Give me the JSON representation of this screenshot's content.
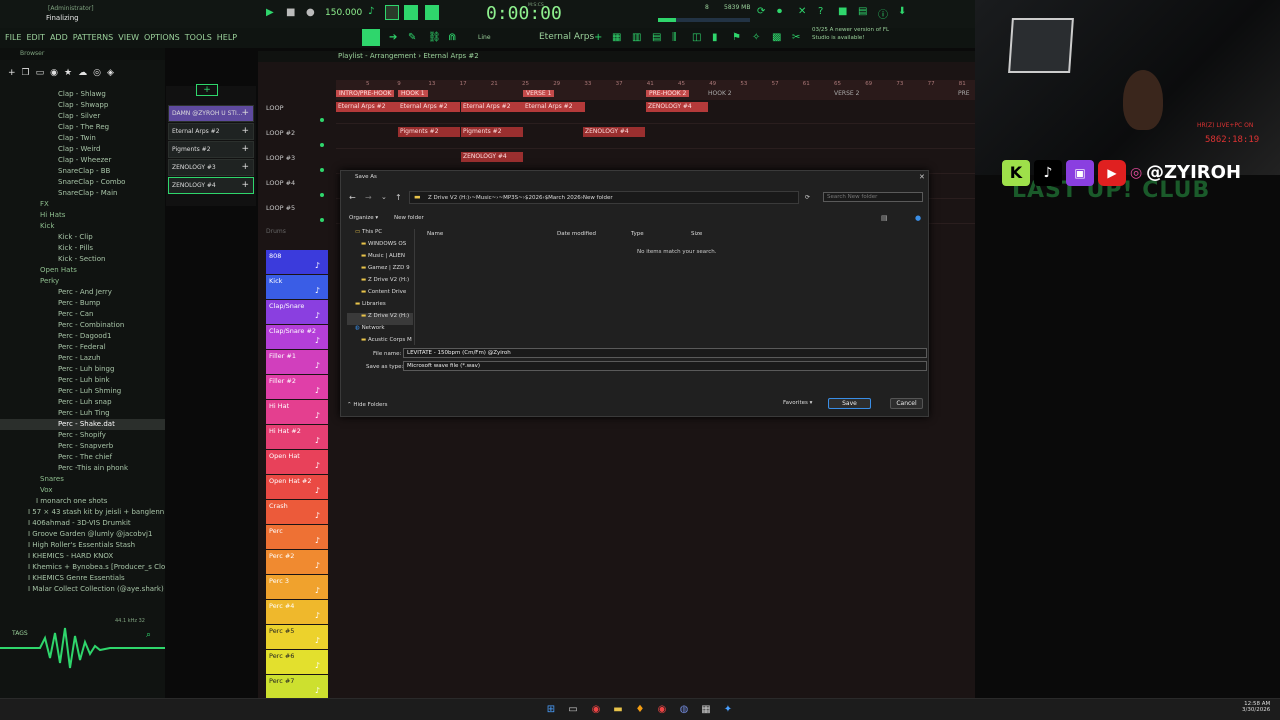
{
  "topbar": {
    "user": "[Administrator]",
    "status": "Finalizing",
    "tempo": "150.000",
    "time": "0:00:00",
    "time_sub": "M:S:CS",
    "cpu": "8",
    "memory": "5839 MB",
    "pattern_name": "Eternal Arps",
    "snap": "Line",
    "hint_time": "03/25",
    "hint_text": "A newer version of FL Studio is available!",
    "counter": "0"
  },
  "menu": [
    "FILE",
    "EDIT",
    "ADD",
    "PATTERNS",
    "VIEW",
    "OPTIONS",
    "TOOLS",
    "HELP"
  ],
  "browser": {
    "title": "Browser",
    "items": [
      "Clap - Shlawg",
      "Clap - Shwapp",
      "Clap - Silver",
      "Clap - The Reg",
      "Clap - Twin",
      "Clap - Weird",
      "Clap - Wheezer",
      "SnareClap - BB",
      "SnareClap - Combo",
      "SnareClap - Main",
      "FX",
      "Hi Hats",
      "Kick",
      "Kick - Clip",
      "Kick - Pills",
      "Kick - Section",
      "Open Hats",
      "Perky",
      "Perc - And Jerry",
      "Perc - Bump",
      "Perc - Can",
      "Perc - Combination",
      "Perc - Dagood1",
      "Perc - Federal",
      "Perc - Lazuh",
      "Perc - Luh bingg",
      "Perc - Luh bink",
      "Perc - Luh Shming",
      "Perc - Luh snap",
      "Perc - Luh Ting",
      "Perc - Shake.dat",
      "Perc - Shopify",
      "Perc - Snapverb",
      "Perc - The chief",
      "Perc -This ain phonk",
      "Snares",
      "Vox",
      "I monarch one shots",
      "I 57 × 43 stash kit by jeisli + banglenn",
      "I 406ahmad - 3D-VIS Drumkit",
      "I Groove Garden @lumly @jacobvj1",
      "I High Roller's Essentials Stash",
      "I KHEMICS - HARD KNOX",
      "I Khemics + Bynobea.s [Producer_s Cloud]",
      "I KHEMICS Genre Essentials",
      "I Malar Collect Collection (@aye.shark)"
    ],
    "sample_rate": "44.1 kHz 32",
    "tags": "TAGS"
  },
  "channels": [
    "DAMN @ZYROH U STI...",
    "Eternal Arps #2",
    "Pigments #2",
    "ZENOLOGY #3",
    "ZENOLOGY #4"
  ],
  "playlist": {
    "title": "Playlist - Arrangement",
    "pattern": "Eternal Arps #2",
    "tracks": [
      "LOOP",
      "LOOP #2",
      "LOOP #3",
      "LOOP #4",
      "LOOP #5"
    ],
    "markers": [
      "INTRO/PRE-HOOK",
      "HOOK 1",
      "VERSE 1",
      "PRE-HOOK 2",
      "HOOK 2",
      "VERSE 2",
      "PRE"
    ],
    "bars": [
      "5",
      "9",
      "13",
      "17",
      "21",
      "25",
      "29",
      "33",
      "37",
      "41",
      "45",
      "49",
      "53",
      "57",
      "61",
      "65",
      "69",
      "73",
      "77",
      "81"
    ],
    "clips": [
      "Eternal Arps #2",
      "Eternal Arps #2",
      "Eternal Arps #2",
      "Eternal Arps #2",
      "Pigments #2",
      "Pigments #2",
      "Pigments #2",
      "ZENOLOGY #4",
      "ZENOLOGY #4"
    ],
    "drums_label": "Drums",
    "drum_tracks": [
      "808",
      "Kick",
      "Clap/Snare",
      "Clap/Snare #2",
      "Filler #1",
      "Filler #2",
      "Hi Hat",
      "Hi Hat #2",
      "Open Hat",
      "Open Hat #2",
      "Crash",
      "Perc",
      "Perc #2",
      "Perc 3",
      "Perc #4",
      "Perc #5",
      "Perc #6",
      "Perc #7"
    ],
    "drum_colors": [
      "#3b3bdc",
      "#3a5de6",
      "#8a3fe0",
      "#b43fd8",
      "#d13fbd",
      "#e03fa8",
      "#e43f8f",
      "#e63f73",
      "#e8415a",
      "#ea4a44",
      "#ec5a3a",
      "#ee7134",
      "#f08a30",
      "#f0a22d",
      "#efb82c",
      "#ecd22c",
      "#e3e02d",
      "#cde02f"
    ]
  },
  "dialog": {
    "title": "Save As",
    "path": [
      "Z Drive V2 (H:)",
      "~Music~",
      "~MP3S~",
      "$2026",
      "$March 2026",
      "New folder"
    ],
    "search_placeholder": "Search New folder",
    "organize": "Organize",
    "new_folder": "New folder",
    "nav": [
      "This PC",
      "WINDOWS OS",
      "Music | ALIEN",
      "Gamez | ZZD 9",
      "Z Drive V2 (H:)",
      "Content Drive",
      "Libraries",
      "Z Drive V2 (H:)",
      "Network",
      "Acustic Corps M"
    ],
    "columns": [
      "Name",
      "Date modified",
      "Type",
      "Size"
    ],
    "empty": "No items match your search.",
    "file_name_label": "File name:",
    "file_name": "LEVITATE - 150bpm (Cm/Fm) @Zyiroh",
    "save_type_label": "Save as type:",
    "save_type": "Microsoft wave file (*.wav)",
    "hide_folders": "Hide Folders",
    "favorites": "Favorites",
    "save": "Save",
    "cancel": "Cancel"
  },
  "webcam": {
    "tag": "HR(Z) LIVE+PC ON",
    "counter": "5862:18:19",
    "overlay": "LAST UP! CLUB"
  },
  "social": {
    "handle": "@ZYIROH"
  },
  "taskbar": {
    "time": "12:58 AM",
    "date": "3/30/2026"
  }
}
